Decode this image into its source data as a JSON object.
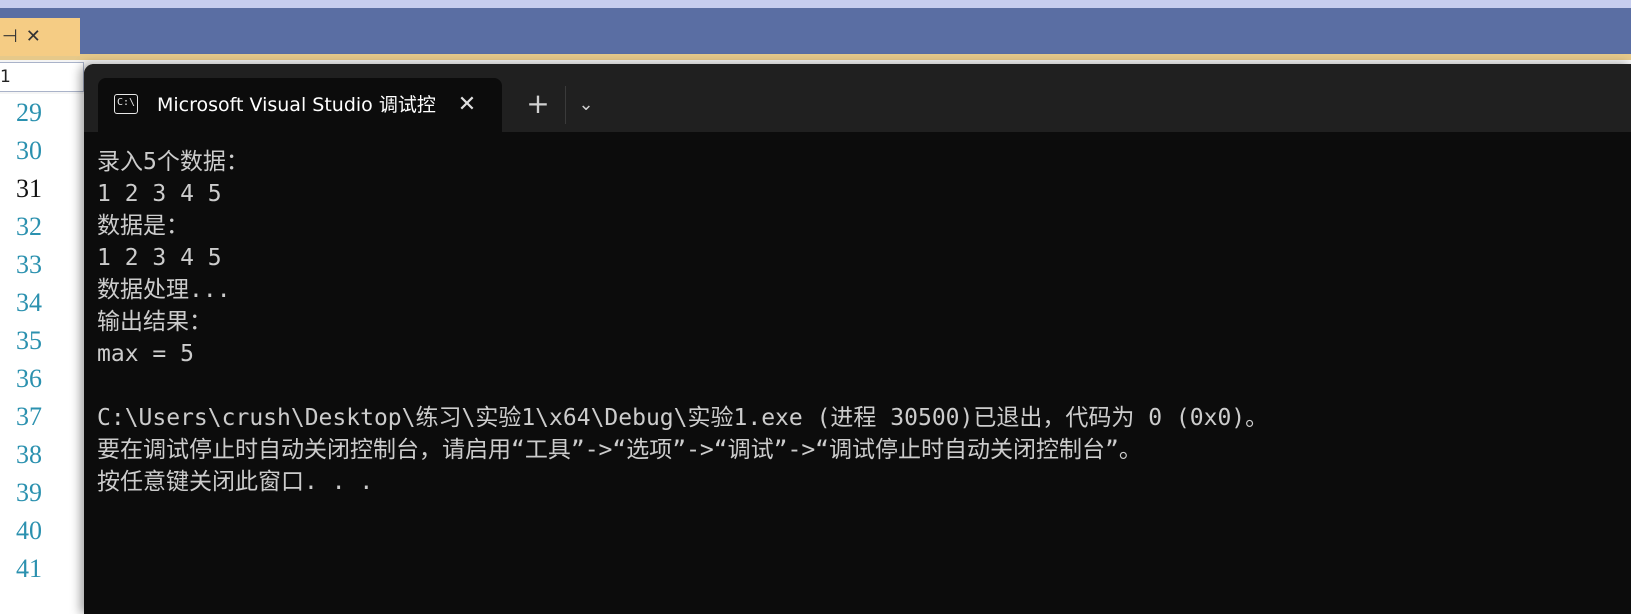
{
  "ide": {
    "breadcrumb": "1",
    "line_numbers": [
      "29",
      "30",
      "31",
      "32",
      "33",
      "34",
      "35",
      "36",
      "37",
      "38",
      "39",
      "40",
      "41"
    ],
    "current_line": "31",
    "icons": [
      "pin-icon",
      "close-icon"
    ]
  },
  "terminal": {
    "tab_title": "Microsoft Visual Studio 调试控",
    "tab_icon_text": "C:\\",
    "close_glyph": "✕",
    "new_tab_glyph": "+",
    "dropdown_glyph": "⌄",
    "lines": [
      "录入5个数据：",
      "1 2 3 4 5",
      "数据是：",
      "1 2 3 4 5",
      "数据处理...",
      "输出结果：",
      "max = 5",
      "",
      "C:\\Users\\crush\\Desktop\\练习\\实验1\\x64\\Debug\\实验1.exe (进程 30500)已退出，代码为 0 (0x0)。",
      "要在调试停止时自动关闭控制台，请启用“工具”->“选项”->“调试”->“调试停止时自动关闭控制台”。",
      "按任意键关闭此窗口. . ."
    ]
  },
  "colors": {
    "terminal_bg": "#0c0c0c",
    "terminal_text": "#cccccc",
    "titlebar": "#202020",
    "vs_band": "#5a6ea3",
    "doc_tab": "#f5cc84",
    "line_number": "#2b91af"
  }
}
